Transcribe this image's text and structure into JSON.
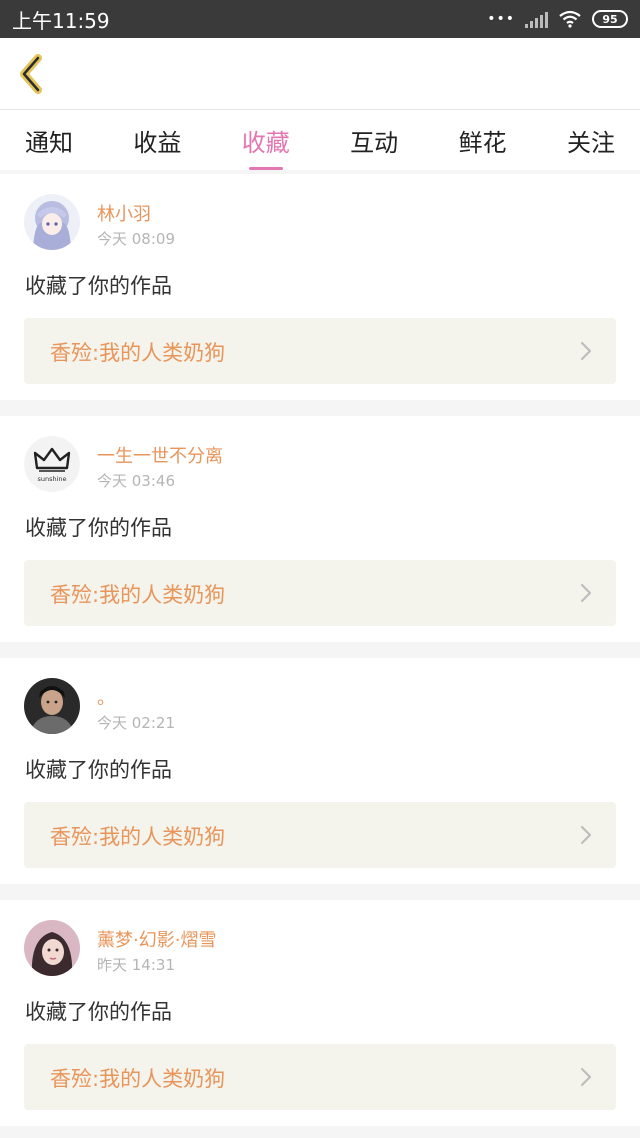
{
  "status_bar": {
    "time": "上午11:59",
    "signal_dots": "•••",
    "battery_level": "95"
  },
  "header": {
    "back_icon": "chevron-left-icon"
  },
  "tabs": [
    {
      "label": "通知",
      "active": false
    },
    {
      "label": "收益",
      "active": false
    },
    {
      "label": "收藏",
      "active": true
    },
    {
      "label": "互动",
      "active": false
    },
    {
      "label": "鲜花",
      "active": false
    },
    {
      "label": "关注",
      "active": false
    }
  ],
  "notifications": [
    {
      "user": "林小羽",
      "time": "今天 08:09",
      "action": "收藏了你的作品",
      "work_title": "香殓:我的人类奶狗",
      "avatar_text": ""
    },
    {
      "user": "一生一世不分离",
      "time": "今天 03:46",
      "action": "收藏了你的作品",
      "work_title": "香殓:我的人类奶狗",
      "avatar_text": "sunshine"
    },
    {
      "user": "。",
      "time": "今天 02:21",
      "action": "收藏了你的作品",
      "work_title": "香殓:我的人类奶狗",
      "avatar_text": ""
    },
    {
      "user": "薰梦·幻影·熠雪",
      "time": "昨天 14:31",
      "action": "收藏了你的作品",
      "work_title": "香殓:我的人类奶狗",
      "avatar_text": ""
    }
  ],
  "colors": {
    "accent": "#e476b1",
    "username": "#e8955a",
    "work_bg": "#f4f3ec",
    "back_icon": "#e3c35a"
  }
}
